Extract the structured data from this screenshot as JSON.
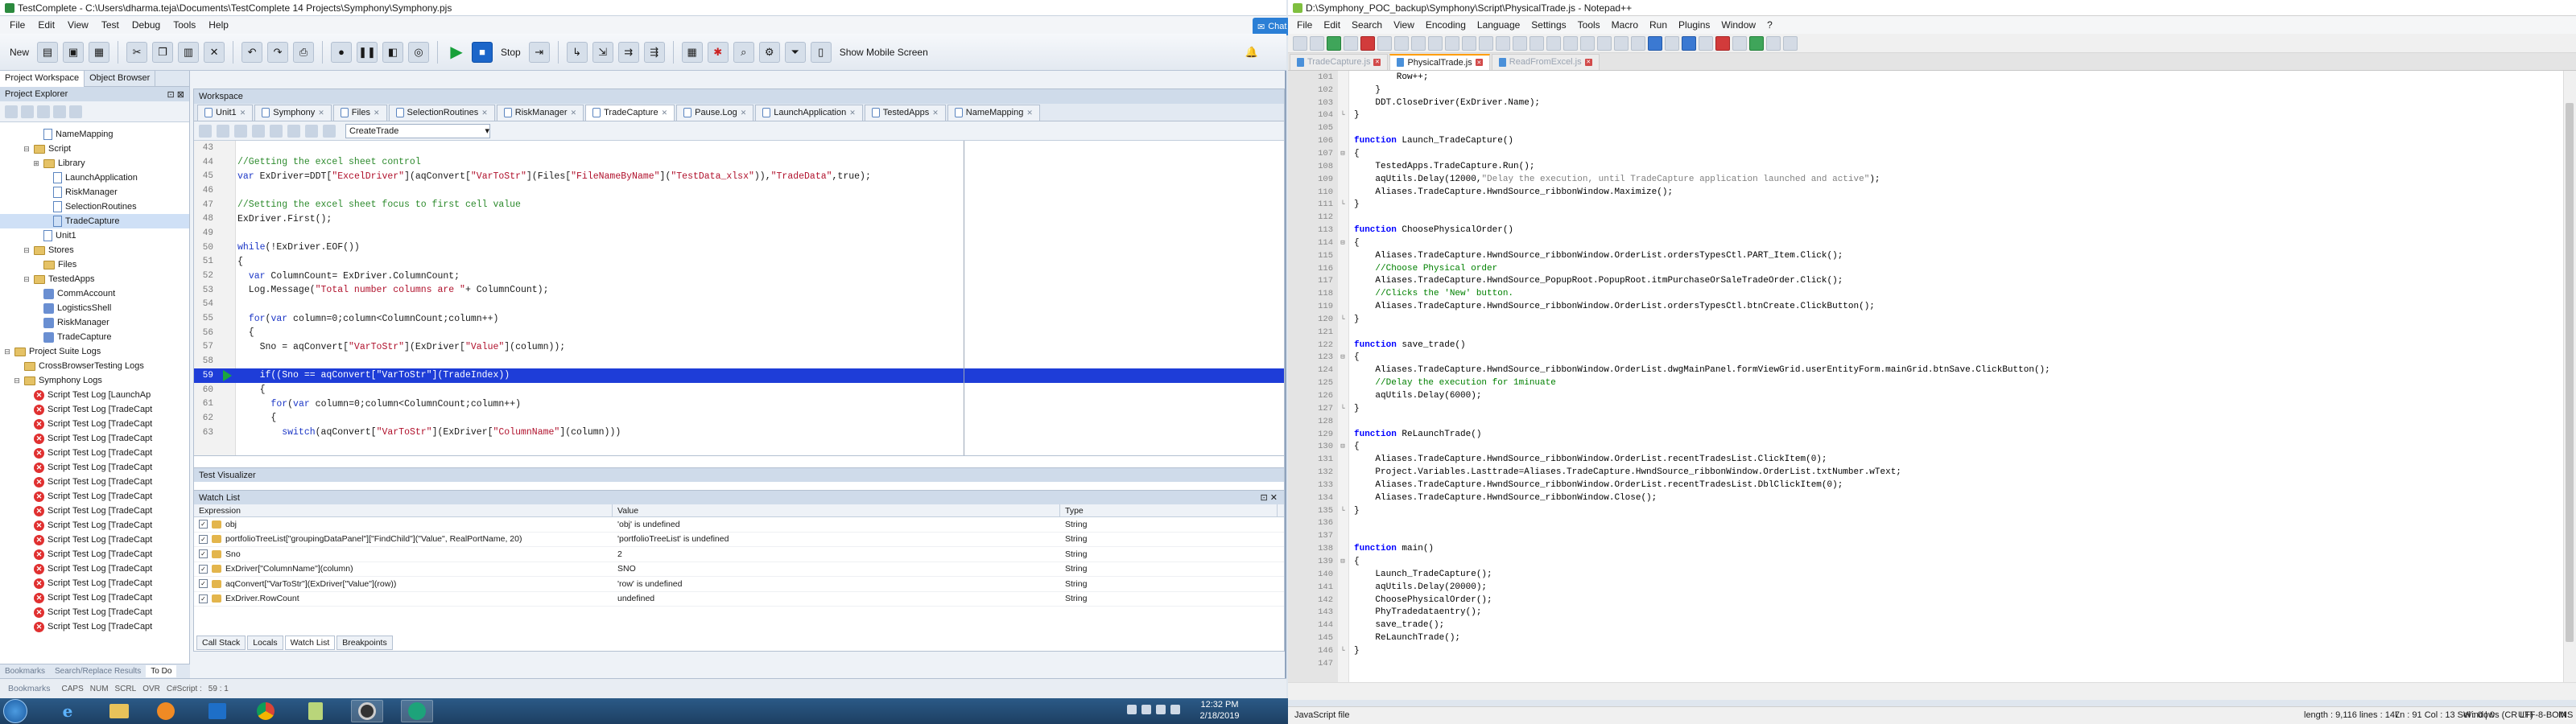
{
  "tc": {
    "title": "TestComplete - C:\\Users\\dharma.teja\\Documents\\TestComplete 14 Projects\\Symphony\\Symphony.pjs",
    "menu": [
      "File",
      "Edit",
      "View",
      "Test",
      "Debug",
      "Tools",
      "Help"
    ],
    "toolbar": {
      "new_label": "New",
      "stop_label": "Stop",
      "mobile_label": "Show Mobile Screen"
    },
    "left_tabs": [
      "Project Workspace",
      "Object Browser"
    ],
    "project_explorer_label": "Project Explorer",
    "tree": [
      {
        "label": "NameMapping",
        "indent": 3,
        "kind": "doc"
      },
      {
        "label": "Script",
        "indent": 2,
        "kind": "folder",
        "toggle": "−"
      },
      {
        "label": "Library",
        "indent": 3,
        "kind": "folder",
        "toggle": "+"
      },
      {
        "label": "LaunchApplication",
        "indent": 4,
        "kind": "doc"
      },
      {
        "label": "RiskManager",
        "indent": 4,
        "kind": "doc"
      },
      {
        "label": "SelectionRoutines",
        "indent": 4,
        "kind": "doc"
      },
      {
        "label": "TradeCapture",
        "indent": 4,
        "kind": "doc",
        "selected": true
      },
      {
        "label": "Unit1",
        "indent": 3,
        "kind": "doc"
      },
      {
        "label": "Stores",
        "indent": 2,
        "kind": "folder",
        "toggle": "−"
      },
      {
        "label": "Files",
        "indent": 3,
        "kind": "folder"
      },
      {
        "label": "TestedApps",
        "indent": 2,
        "kind": "folder",
        "toggle": "−"
      },
      {
        "label": "CommAccount",
        "indent": 3,
        "kind": "cmp"
      },
      {
        "label": "LogisticsShell",
        "indent": 3,
        "kind": "cmp"
      },
      {
        "label": "RiskManager",
        "indent": 3,
        "kind": "cmp"
      },
      {
        "label": "TradeCapture",
        "indent": 3,
        "kind": "cmp"
      },
      {
        "label": "Project Suite Logs",
        "indent": 0,
        "kind": "folder",
        "toggle": "−"
      },
      {
        "label": "CrossBrowserTesting Logs",
        "indent": 1,
        "kind": "folder"
      },
      {
        "label": "Symphony Logs",
        "indent": 1,
        "kind": "folder",
        "toggle": "−"
      },
      {
        "label": "Script Test Log [LaunchAp",
        "indent": 2,
        "kind": "err"
      },
      {
        "label": "Script Test Log [TradeCapt",
        "indent": 2,
        "kind": "err"
      },
      {
        "label": "Script Test Log [TradeCapt",
        "indent": 2,
        "kind": "err"
      },
      {
        "label": "Script Test Log [TradeCapt",
        "indent": 2,
        "kind": "err"
      },
      {
        "label": "Script Test Log [TradeCapt",
        "indent": 2,
        "kind": "err"
      },
      {
        "label": "Script Test Log [TradeCapt",
        "indent": 2,
        "kind": "err"
      },
      {
        "label": "Script Test Log [TradeCapt",
        "indent": 2,
        "kind": "err"
      },
      {
        "label": "Script Test Log [TradeCapt",
        "indent": 2,
        "kind": "err"
      },
      {
        "label": "Script Test Log [TradeCapt",
        "indent": 2,
        "kind": "err"
      },
      {
        "label": "Script Test Log [TradeCapt",
        "indent": 2,
        "kind": "err"
      },
      {
        "label": "Script Test Log [TradeCapt",
        "indent": 2,
        "kind": "err"
      },
      {
        "label": "Script Test Log [TradeCapt",
        "indent": 2,
        "kind": "err"
      },
      {
        "label": "Script Test Log [TradeCapt",
        "indent": 2,
        "kind": "err"
      },
      {
        "label": "Script Test Log [TradeCapt",
        "indent": 2,
        "kind": "err"
      },
      {
        "label": "Script Test Log [TradeCapt",
        "indent": 2,
        "kind": "err"
      },
      {
        "label": "Script Test Log [TradeCapt",
        "indent": 2,
        "kind": "err"
      },
      {
        "label": "Script Test Log [TradeCapt",
        "indent": 2,
        "kind": "err"
      }
    ],
    "left_bottom_tabs": [
      "Bookmarks",
      "Search/Replace Results",
      "To Do"
    ],
    "workspace_label": "Workspace",
    "editor_tabs": [
      "Unit1",
      "Symphony",
      "Files",
      "SelectionRoutines",
      "RiskManager",
      "TradeCapture",
      "Pause.Log",
      "LaunchApplication",
      "TestedApps",
      "NameMapping"
    ],
    "active_editor_tab": "TradeCapture",
    "routine": "CreateTrade",
    "code_lines": [
      {
        "n": "43",
        "t": ""
      },
      {
        "n": "44",
        "t": "//Getting the excel sheet control",
        "cls": "c-com"
      },
      {
        "n": "45",
        "t": "var ExDriver=DDT[\"ExcelDriver\"](aqConvert[\"VarToStr\"](Files[\"FileNameByName\"](\"TestData_xlsx\")),\"TradeData\",true);"
      },
      {
        "n": "46",
        "t": ""
      },
      {
        "n": "47",
        "t": "//Setting the excel sheet focus to first cell value",
        "cls": "c-com"
      },
      {
        "n": "48",
        "t": "ExDriver.First();"
      },
      {
        "n": "49",
        "t": ""
      },
      {
        "n": "50",
        "t": "while(!ExDriver.EOF())"
      },
      {
        "n": "51",
        "t": "{"
      },
      {
        "n": "52",
        "t": "  var ColumnCount= ExDriver.ColumnCount;"
      },
      {
        "n": "53",
        "t": "  Log.Message(\"Total number columns are \"+ ColumnCount);"
      },
      {
        "n": "54",
        "t": ""
      },
      {
        "n": "55",
        "t": "  for(var column=0;column<ColumnCount;column++)"
      },
      {
        "n": "56",
        "t": "  {"
      },
      {
        "n": "57",
        "t": "    Sno = aqConvert[\"VarToStr\"](ExDriver[\"Value\"](column));"
      },
      {
        "n": "58",
        "t": ""
      },
      {
        "n": "59",
        "t": "    if((Sno == aqConvert[\"VarToStr\"](TradeIndex))",
        "hl": true
      },
      {
        "n": "60",
        "t": "    {"
      },
      {
        "n": "61",
        "t": "      for(var column=0;column<ColumnCount;column++)"
      },
      {
        "n": "62",
        "t": "      {"
      },
      {
        "n": "63",
        "t": "        switch(aqConvert[\"VarToStr\"](ExDriver[\"ColumnName\"](column)))"
      }
    ],
    "test_visualizer_label": "Test Visualizer",
    "watch_list_label": "Watch List",
    "watch_columns": [
      "Expression",
      "Value",
      "Type"
    ],
    "watch_rows": [
      {
        "expr": "obj",
        "value": "'obj' is undefined",
        "type": "String"
      },
      {
        "expr": "portfolioTreeList[\"groupingDataPanel\"][\"FindChild\"](\"Value\", RealPortName, 20)",
        "value": "'portfolioTreeList' is undefined",
        "type": "String"
      },
      {
        "expr": "Sno",
        "value": "2",
        "type": "String"
      },
      {
        "expr": "ExDriver[\"ColumnName\"](column)",
        "value": "SNO",
        "type": "String"
      },
      {
        "expr": "aqConvert[\"VarToStr\"](ExDriver[\"Value\"](row))",
        "value": "'row' is undefined",
        "type": "String"
      },
      {
        "expr": "ExDriver.RowCount",
        "value": "undefined",
        "type": "String"
      }
    ],
    "bottom_tabs": [
      "Call Stack",
      "Locals",
      "Watch List",
      "Breakpoints"
    ],
    "active_bottom_tab": "Watch List",
    "status_left": [
      "CAPS",
      "NUM",
      "SCRL",
      "OVR",
      "C#Script :",
      "59 : 1"
    ]
  },
  "chat_label": "Chat",
  "npp": {
    "title": "D:\\Symphony_POC_backup\\Symphony\\Script\\PhysicalTrade.js - Notepad++",
    "menu": [
      "File",
      "Edit",
      "Search",
      "View",
      "Encoding",
      "Language",
      "Settings",
      "Tools",
      "Macro",
      "Run",
      "Plugins",
      "Window",
      "?"
    ],
    "tabs": [
      "TradeCapture.js",
      "PhysicalTrade.js",
      "ReadFromExcel.js"
    ],
    "active_tab": "PhysicalTrade.js",
    "code_lines": [
      {
        "n": "101",
        "t": "        Row++;"
      },
      {
        "n": "102",
        "t": "    }"
      },
      {
        "n": "103",
        "t": "    DDT.CloseDriver(ExDriver.Name);"
      },
      {
        "n": "104",
        "t": "}",
        "fold": "└"
      },
      {
        "n": "105",
        "t": ""
      },
      {
        "n": "106",
        "t": "function Launch_TradeCapture()"
      },
      {
        "n": "107",
        "t": "{",
        "fold": "⊟"
      },
      {
        "n": "108",
        "t": "    TestedApps.TradeCapture.Run();"
      },
      {
        "n": "109",
        "t": "    aqUtils.Delay(12000,\"Delay the execution, until TradeCapture application launched and active\");"
      },
      {
        "n": "110",
        "t": "    Aliases.TradeCapture.HwndSource_ribbonWindow.Maximize();"
      },
      {
        "n": "111",
        "t": "}",
        "fold": "└"
      },
      {
        "n": "112",
        "t": ""
      },
      {
        "n": "113",
        "t": "function ChoosePhysicalOrder()"
      },
      {
        "n": "114",
        "t": "{",
        "fold": "⊟"
      },
      {
        "n": "115",
        "t": "    Aliases.TradeCapture.HwndSource_ribbonWindow.OrderList.ordersTypesCtl.PART_Item.Click();"
      },
      {
        "n": "116",
        "t": "    //Choose Physical order",
        "cls": "n-com"
      },
      {
        "n": "117",
        "t": "    Aliases.TradeCapture.HwndSource_PopupRoot.PopupRoot.itmPurchaseOrSaleTradeOrder.Click();"
      },
      {
        "n": "118",
        "t": "    //Clicks the 'New' button.",
        "cls": "n-com"
      },
      {
        "n": "119",
        "t": "    Aliases.TradeCapture.HwndSource_ribbonWindow.OrderList.ordersTypesCtl.btnCreate.ClickButton();"
      },
      {
        "n": "120",
        "t": "}",
        "fold": "└"
      },
      {
        "n": "121",
        "t": ""
      },
      {
        "n": "122",
        "t": "function save_trade()"
      },
      {
        "n": "123",
        "t": "{",
        "fold": "⊟"
      },
      {
        "n": "124",
        "t": "    Aliases.TradeCapture.HwndSource_ribbonWindow.OrderList.dwgMainPanel.formViewGrid.userEntityForm.mainGrid.btnSave.ClickButton();"
      },
      {
        "n": "125",
        "t": "    //Delay the execution for 1minuate",
        "cls": "n-com"
      },
      {
        "n": "126",
        "t": "    aqUtils.Delay(6000);"
      },
      {
        "n": "127",
        "t": "}",
        "fold": "└"
      },
      {
        "n": "128",
        "t": ""
      },
      {
        "n": "129",
        "t": "function ReLaunchTrade()"
      },
      {
        "n": "130",
        "t": "{",
        "fold": "⊟"
      },
      {
        "n": "131",
        "t": "    Aliases.TradeCapture.HwndSource_ribbonWindow.OrderList.recentTradesList.ClickItem(0);"
      },
      {
        "n": "132",
        "t": "    Project.Variables.Lasttrade=Aliases.TradeCapture.HwndSource_ribbonWindow.OrderList.txtNumber.wText;"
      },
      {
        "n": "133",
        "t": "    Aliases.TradeCapture.HwndSource_ribbonWindow.OrderList.recentTradesList.DblClickItem(0);"
      },
      {
        "n": "134",
        "t": "    Aliases.TradeCapture.HwndSource_ribbonWindow.Close();"
      },
      {
        "n": "135",
        "t": "}",
        "fold": "└"
      },
      {
        "n": "136",
        "t": ""
      },
      {
        "n": "137",
        "t": ""
      },
      {
        "n": "138",
        "t": "function main()"
      },
      {
        "n": "139",
        "t": "{",
        "fold": "⊟"
      },
      {
        "n": "140",
        "t": "    Launch_TradeCapture();"
      },
      {
        "n": "141",
        "t": "    aqUtils.Delay(20000);"
      },
      {
        "n": "142",
        "t": "    ChoosePhysicalOrder();"
      },
      {
        "n": "143",
        "t": "    PhyTradedataentry();"
      },
      {
        "n": "144",
        "t": "    save_trade();"
      },
      {
        "n": "145",
        "t": "    ReLaunchTrade();"
      },
      {
        "n": "146",
        "t": "}",
        "fold": "└"
      },
      {
        "n": "147",
        "t": ""
      }
    ],
    "status": {
      "file_type": "JavaScript file",
      "length_lines": "length : 9,116    lines : 147",
      "position": "Ln : 91    Col : 13    Sel : 0 | 0",
      "eol": "Windows (CR LF)",
      "encoding": "UTF-8-BOM",
      "mode": "INS"
    }
  },
  "taskbar": {
    "time": "12:32 PM",
    "date": "2/18/2019"
  }
}
